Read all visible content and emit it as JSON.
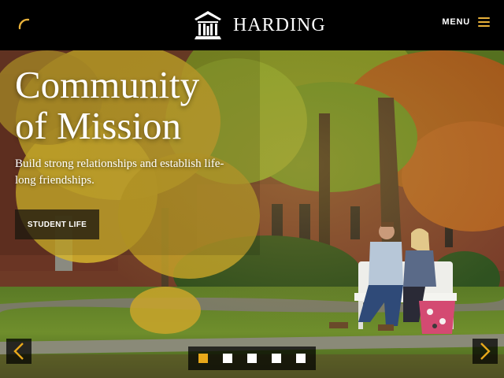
{
  "header": {
    "brand_name": "HARDING",
    "menu_label": "MENU",
    "accent_color": "#e8b13a"
  },
  "hero": {
    "headline_line1": "Community",
    "headline_line2": "of Mission",
    "subheadline": "Build strong relationships and establish life-long friendships.",
    "cta_label": "STUDENT LIFE"
  },
  "carousel": {
    "slide_count": 5,
    "active_slide": 1,
    "prev_icon": "chevron-left-icon",
    "next_icon": "chevron-right-icon"
  },
  "icons": {
    "loading": "loading-spinner-icon",
    "logo": "harding-building-logo-icon",
    "menu": "hamburger-menu-icon"
  }
}
